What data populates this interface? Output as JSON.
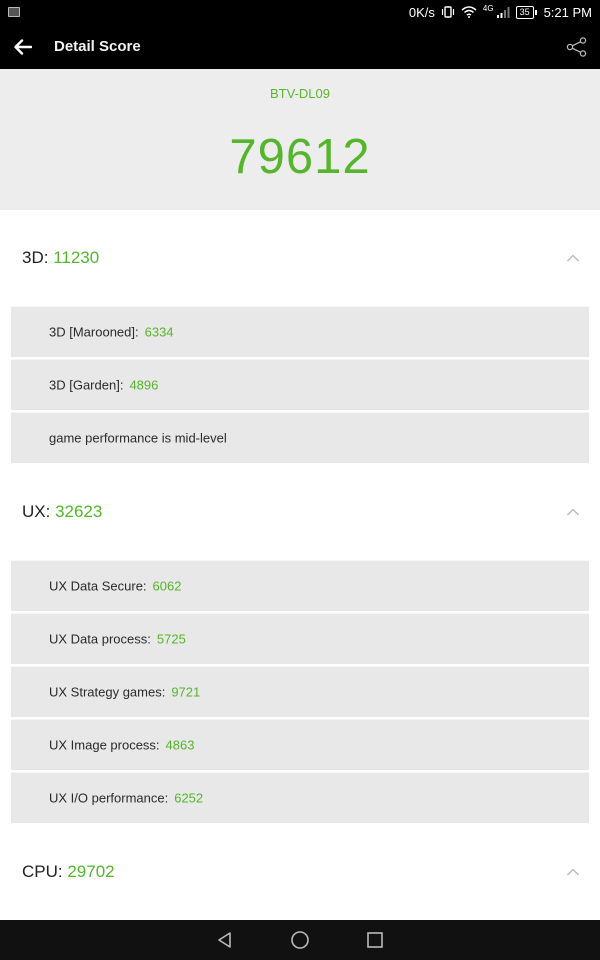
{
  "status_bar": {
    "speed": "0K/s",
    "network": "4G",
    "battery": "35",
    "time": "5:21 PM"
  },
  "app_bar": {
    "title": "Detail Score"
  },
  "header": {
    "device": "BTV-DL09",
    "total_score": "79612"
  },
  "sections": {
    "s3d": {
      "label": "3D: ",
      "value": "11230",
      "items": [
        {
          "label": "3D [Marooned]:",
          "value": "6334"
        },
        {
          "label": "3D [Garden]:",
          "value": "4896"
        },
        {
          "label": "game performance is mid-level",
          "value": ""
        }
      ]
    },
    "ux": {
      "label": "UX: ",
      "value": "32623",
      "items": [
        {
          "label": "UX Data Secure:",
          "value": "6062"
        },
        {
          "label": "UX Data process:",
          "value": "5725"
        },
        {
          "label": "UX Strategy games:",
          "value": "9721"
        },
        {
          "label": "UX Image process:",
          "value": "4863"
        },
        {
          "label": "UX I/O performance:",
          "value": "6252"
        }
      ]
    },
    "cpu": {
      "label": "CPU: ",
      "value": "29702"
    }
  },
  "colors": {
    "accent": "#55b52c",
    "bar": "#000000"
  },
  "icons": {
    "back": "arrow-left-icon",
    "share": "share-icon",
    "chevron": "chevron-up-icon",
    "nav_back": "triangle-back-icon",
    "nav_home": "circle-home-icon",
    "nav_recents": "square-recents-icon"
  }
}
